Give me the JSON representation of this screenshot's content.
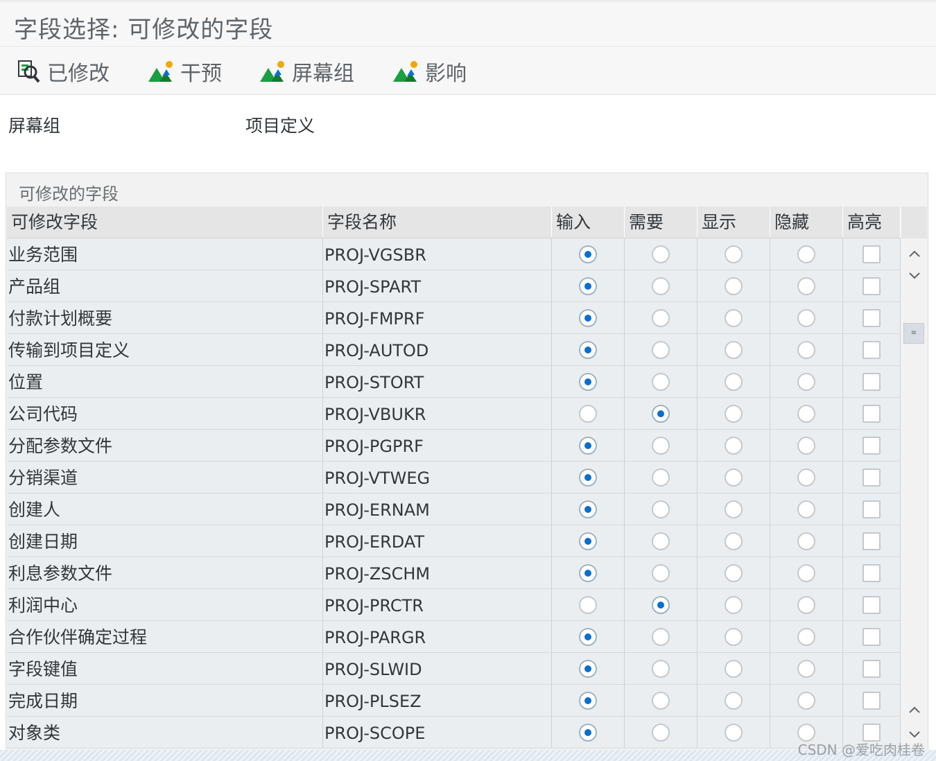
{
  "window": {
    "title": "字段选择: 可修改的字段"
  },
  "toolbar": {
    "buttons": [
      {
        "label": "已修改",
        "icon": "modified-search-icon"
      },
      {
        "label": "干预",
        "icon": "mountain-sun-icon"
      },
      {
        "label": "屏幕组",
        "icon": "mountain-sun-icon"
      },
      {
        "label": "影响",
        "icon": "mountain-sun-icon"
      }
    ]
  },
  "header": {
    "label": "屏幕组",
    "value": "项目定义"
  },
  "panel": {
    "title": "可修改的字段"
  },
  "table": {
    "columns": [
      "可修改字段",
      "字段名称",
      "输入",
      "需要",
      "显示",
      "隐藏",
      "高亮"
    ],
    "rows": [
      {
        "desc": "业务范围",
        "field": "PROJ-VGSBR",
        "selected": "输入",
        "highlight": false
      },
      {
        "desc": "产品组",
        "field": "PROJ-SPART",
        "selected": "输入",
        "highlight": false
      },
      {
        "desc": "付款计划概要",
        "field": "PROJ-FMPRF",
        "selected": "输入",
        "highlight": false
      },
      {
        "desc": "传输到项目定义",
        "field": "PROJ-AUTOD",
        "selected": "输入",
        "highlight": false
      },
      {
        "desc": "位置",
        "field": "PROJ-STORT",
        "selected": "输入",
        "highlight": false
      },
      {
        "desc": "公司代码",
        "field": "PROJ-VBUKR",
        "selected": "需要",
        "highlight": false
      },
      {
        "desc": "分配参数文件",
        "field": "PROJ-PGPRF",
        "selected": "输入",
        "highlight": false
      },
      {
        "desc": "分销渠道",
        "field": "PROJ-VTWEG",
        "selected": "输入",
        "highlight": false
      },
      {
        "desc": "创建人",
        "field": "PROJ-ERNAM",
        "selected": "输入",
        "highlight": false
      },
      {
        "desc": "创建日期",
        "field": "PROJ-ERDAT",
        "selected": "输入",
        "highlight": false
      },
      {
        "desc": "利息参数文件",
        "field": "PROJ-ZSCHM",
        "selected": "输入",
        "highlight": false
      },
      {
        "desc": "利润中心",
        "field": "PROJ-PRCTR",
        "selected": "需要",
        "highlight": false
      },
      {
        "desc": "合作伙伴确定过程",
        "field": "PROJ-PARGR",
        "selected": "输入",
        "highlight": false
      },
      {
        "desc": "字段键值",
        "field": "PROJ-SLWID",
        "selected": "输入",
        "highlight": false
      },
      {
        "desc": "完成日期",
        "field": "PROJ-PLSEZ",
        "selected": "输入",
        "highlight": false
      },
      {
        "desc": "对象类",
        "field": "PROJ-SCOPE",
        "selected": "输入",
        "highlight": false
      }
    ]
  },
  "scrollbar": {
    "icons": [
      "chevron-up-icon",
      "chevron-down-icon",
      "chevron-up-icon",
      "chevron-down-icon"
    ]
  },
  "watermark": "CSDN @爱吃肉桂卷",
  "colors": {
    "accent": "#0a6ed1",
    "row_bg": "#ebeef0",
    "header_bg": "#e5e5e5",
    "green": "#1a9e3f",
    "orange": "#f0a800"
  }
}
